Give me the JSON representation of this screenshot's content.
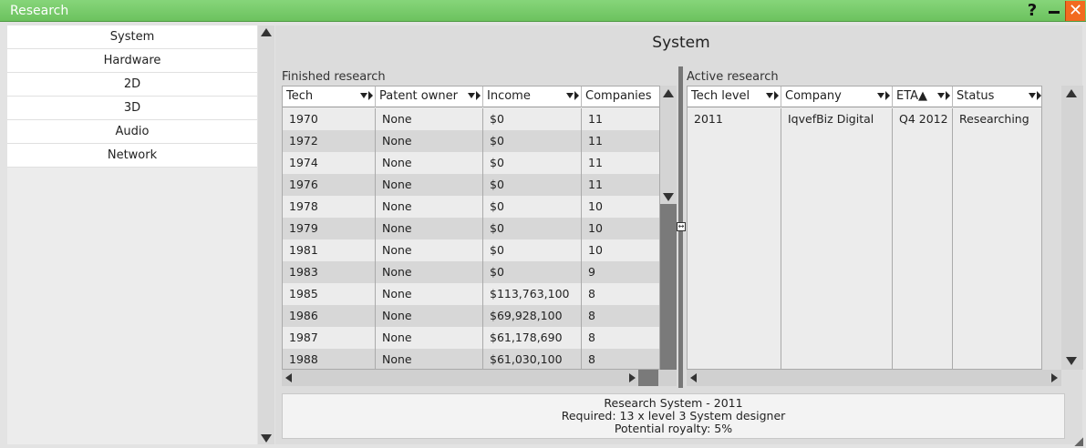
{
  "window": {
    "title": "Research",
    "help_label": "?"
  },
  "sidebar": {
    "items": [
      {
        "label": "System"
      },
      {
        "label": "Hardware"
      },
      {
        "label": "2D"
      },
      {
        "label": "3D"
      },
      {
        "label": "Audio"
      },
      {
        "label": "Network"
      }
    ]
  },
  "main": {
    "title": "System",
    "finished": {
      "label": "Finished research",
      "columns": [
        "Tech",
        "Patent owner",
        "Income",
        "Companies"
      ],
      "rows": [
        [
          "1970",
          "None",
          "$0",
          "11"
        ],
        [
          "1972",
          "None",
          "$0",
          "11"
        ],
        [
          "1974",
          "None",
          "$0",
          "11"
        ],
        [
          "1976",
          "None",
          "$0",
          "11"
        ],
        [
          "1978",
          "None",
          "$0",
          "10"
        ],
        [
          "1979",
          "None",
          "$0",
          "10"
        ],
        [
          "1981",
          "None",
          "$0",
          "10"
        ],
        [
          "1983",
          "None",
          "$0",
          "9"
        ],
        [
          "1985",
          "None",
          "$113,763,100",
          "8"
        ],
        [
          "1986",
          "None",
          "$69,928,100",
          "8"
        ],
        [
          "1987",
          "None",
          "$61,178,690",
          "8"
        ],
        [
          "1988",
          "None",
          "$61,030,100",
          "8"
        ]
      ]
    },
    "active": {
      "label": "Active research",
      "columns": [
        "Tech level",
        "Company",
        "ETA▲",
        "Status"
      ],
      "rows": [
        [
          "2011",
          "IqvefBiz Digital",
          "Q4 2012",
          "Researching"
        ]
      ]
    },
    "info": {
      "line1": "Research System - 2011",
      "line2": "Required: 13 x level 3 System designer",
      "line3": "Potential royalty: 5%"
    }
  },
  "colors": {
    "titlebar": "#6cc25e",
    "close": "#f26a1f"
  }
}
